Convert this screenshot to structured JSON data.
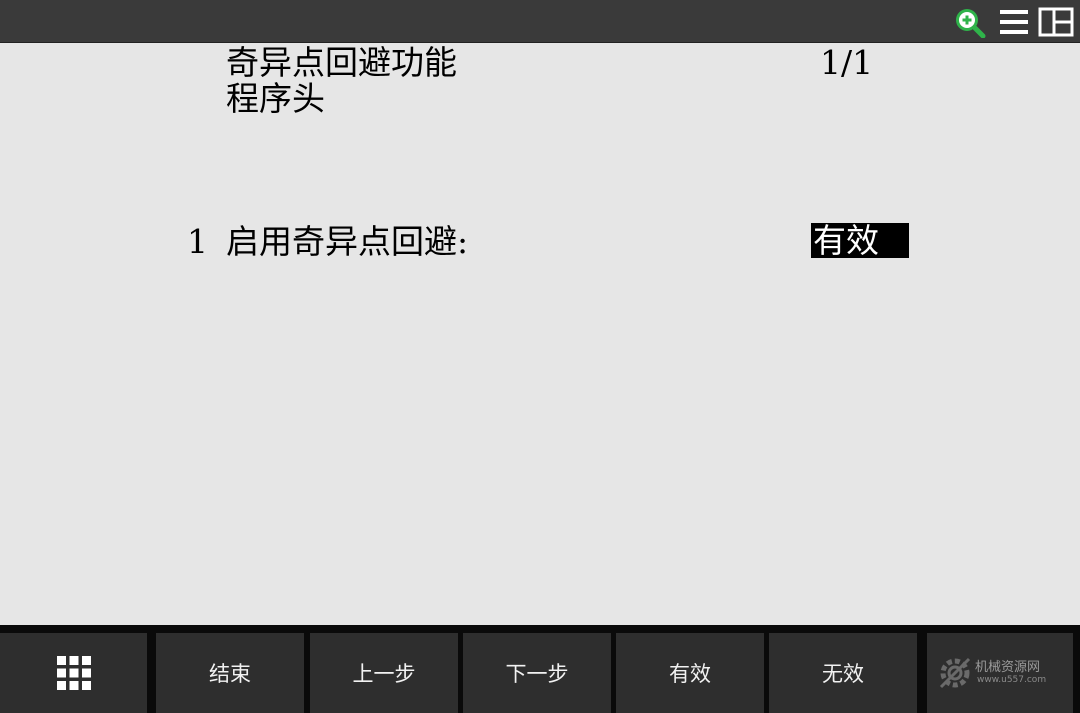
{
  "colors": {
    "topbar_bg": "#3a3a3a",
    "content_bg": "#e6e6e6",
    "fkey_bg": "#2e2e2e",
    "accent_green": "#2fb34a",
    "highlight_bg": "#000000",
    "highlight_text": "#ffffff"
  },
  "topbar": {
    "icons": [
      "zoom-in-icon",
      "menu-icon",
      "split-window-icon"
    ]
  },
  "screen": {
    "title": "奇异点回避功能",
    "subtitle": "程序头",
    "page_indicator": "1/1",
    "items": [
      {
        "number": "1",
        "label": "启用奇异点回避:",
        "value": "有效"
      }
    ]
  },
  "function_keys": {
    "grid_icon": "grid-menu-icon",
    "keys": [
      "结束",
      "上一步",
      "下一步",
      "有效",
      "无效"
    ]
  },
  "watermark": {
    "text": "机械资源网",
    "url": "www.u557.com",
    "icon": "gear-logo-icon"
  }
}
